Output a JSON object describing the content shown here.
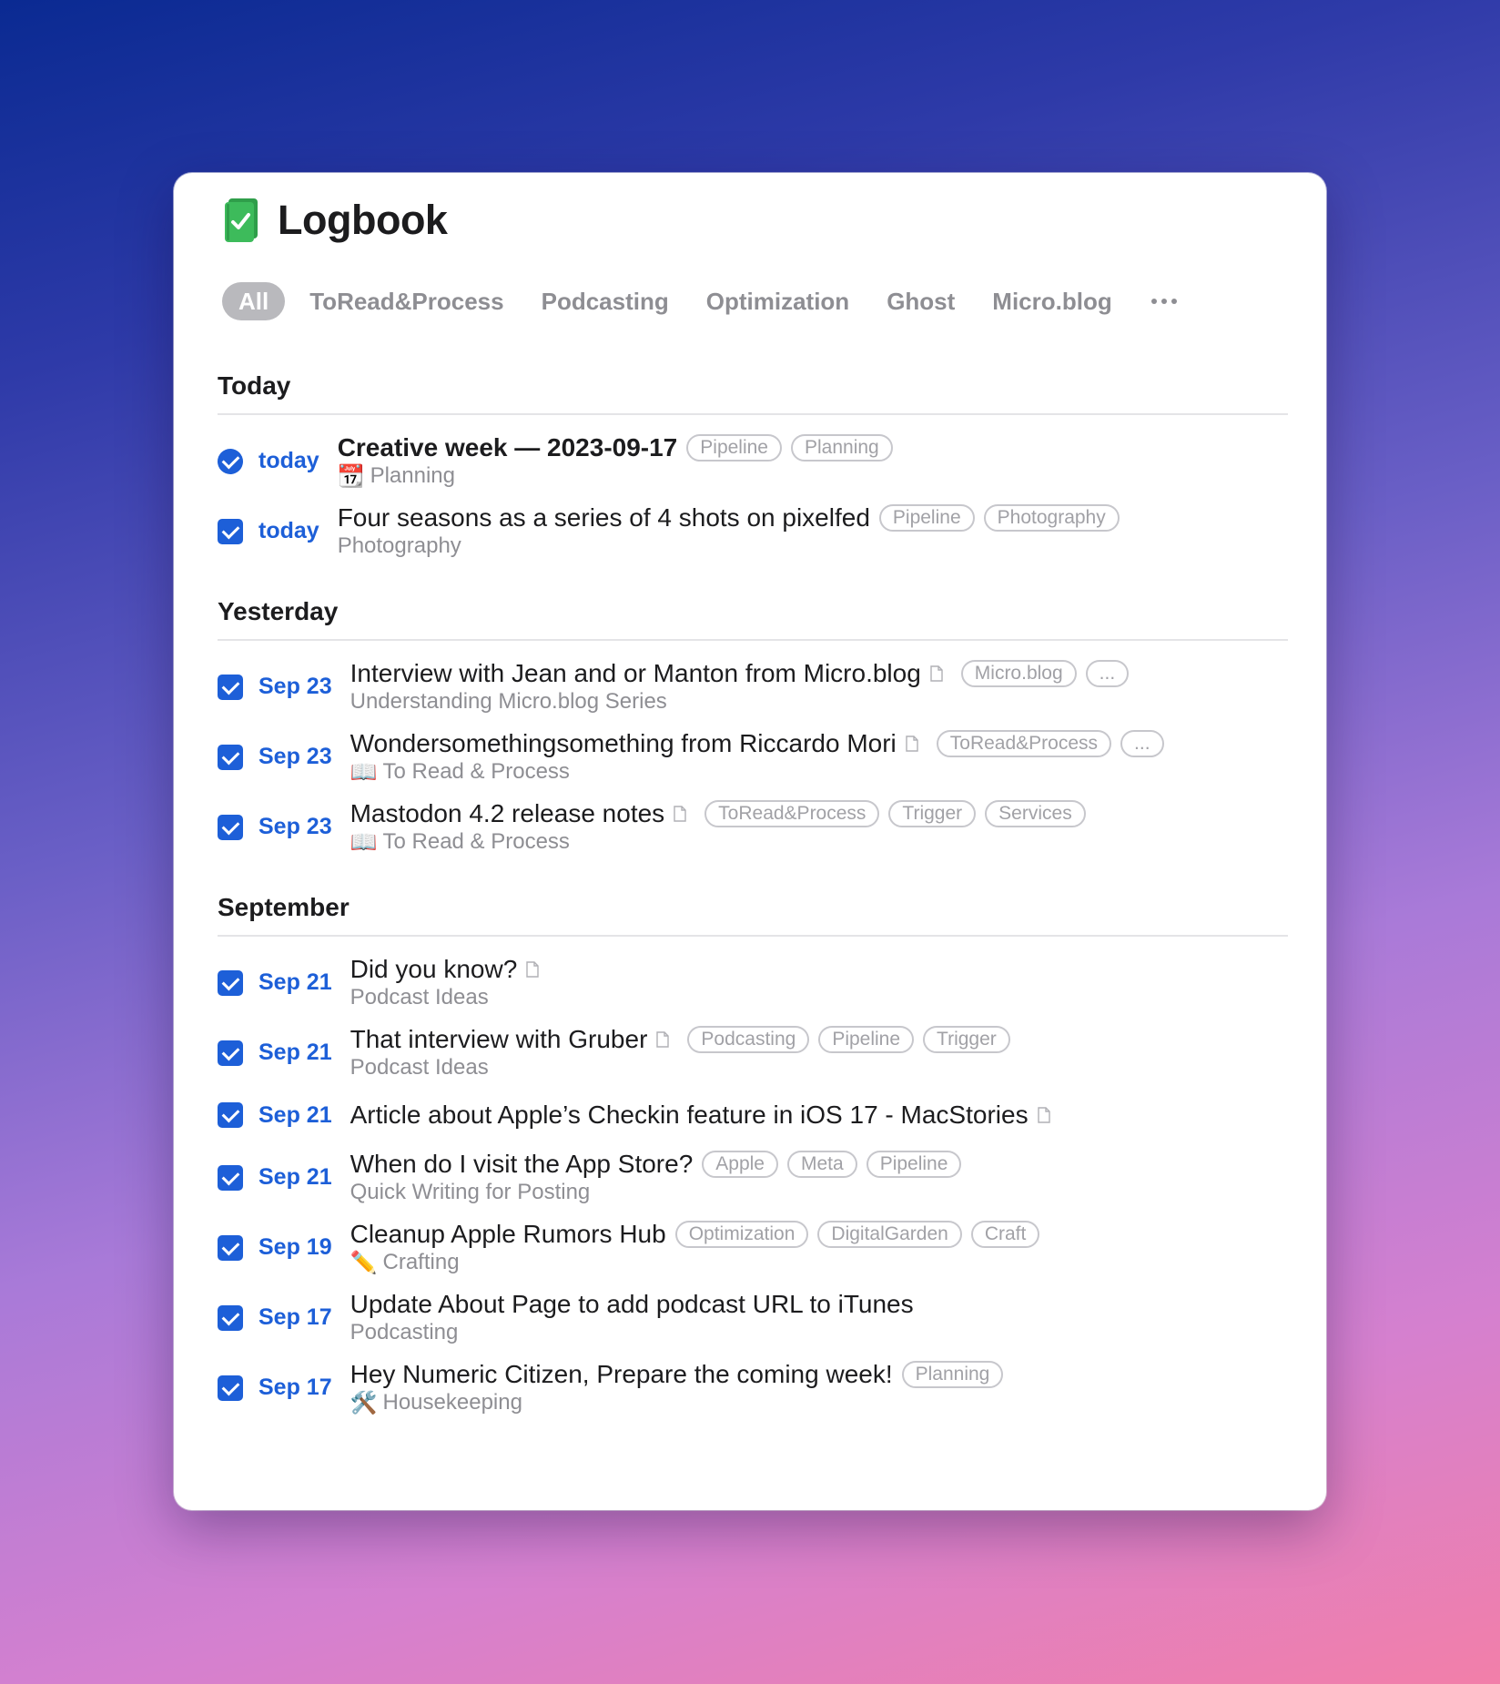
{
  "app": {
    "title": "Logbook",
    "icon": "logbook-book-icon",
    "accent": "#1d5fd8",
    "icon_color": "#3dbb5b"
  },
  "tabs": [
    {
      "label": "All",
      "active": true
    },
    {
      "label": "ToRead&Process"
    },
    {
      "label": "Podcasting"
    },
    {
      "label": "Optimization"
    },
    {
      "label": "Ghost"
    },
    {
      "label": "Micro.blog"
    }
  ],
  "tabs_more_icon": "ellipsis-icon",
  "sections": {
    "today": {
      "title": "Today",
      "items": [
        {
          "date": "today",
          "title": "Creative week — 2023-09-17",
          "subtitle_icon": "📆",
          "subtitle": "Planning",
          "tags": [
            "Pipeline",
            "Planning"
          ]
        },
        {
          "date": "today",
          "title": "Four seasons as a series of 4 shots on pixelfed",
          "subtitle": "Photography",
          "tags": [
            "Pipeline",
            "Photography"
          ]
        }
      ]
    },
    "yesterday": {
      "title": "Yesterday",
      "items": [
        {
          "date": "Sep 23",
          "title": "Interview with Jean and or Manton from Micro.blog",
          "subtitle": "Understanding Micro.blog Series",
          "tags": [
            "Micro.blog",
            "..."
          ]
        },
        {
          "date": "Sep 23",
          "title": "Wondersomethingsomething from Riccardo Mori",
          "subtitle_icon": "📖",
          "subtitle": "To Read & Process",
          "tags": [
            "ToRead&Process",
            "..."
          ]
        },
        {
          "date": "Sep 23",
          "title": "Mastodon 4.2 release notes",
          "subtitle_icon": "📖",
          "subtitle": "To Read & Process",
          "tags": [
            "ToRead&Process",
            "Trigger",
            "Services"
          ]
        }
      ]
    },
    "september": {
      "title": "September",
      "items": [
        {
          "date": "Sep 21",
          "title": "Did you know?",
          "subtitle": "Podcast Ideas"
        },
        {
          "date": "Sep 21",
          "title": "That interview with Gruber",
          "subtitle": "Podcast Ideas",
          "tags": [
            "Podcasting",
            "Pipeline",
            "Trigger"
          ]
        },
        {
          "date": "Sep 21",
          "title": "Article about Apple’s Checkin feature in iOS 17 - MacStories"
        },
        {
          "date": "Sep 21",
          "title": "When do I visit the App Store?",
          "subtitle": "Quick Writing for Posting",
          "tags": [
            "Apple",
            "Meta",
            "Pipeline"
          ]
        },
        {
          "date": "Sep 19",
          "title": "Cleanup Apple Rumors Hub",
          "subtitle_icon": "✏️",
          "subtitle": "Crafting",
          "tags": [
            "Optimization",
            "DigitalGarden",
            "Craft"
          ]
        },
        {
          "date": "Sep 17",
          "title": "Update About Page to add podcast URL to iTunes",
          "subtitle": "Podcasting"
        },
        {
          "date": "Sep 17",
          "title": "Hey Numeric Citizen, Prepare the coming week!",
          "subtitle_icon": "🛠️",
          "subtitle": "Housekeeping",
          "tags": [
            "Planning"
          ]
        }
      ]
    }
  }
}
